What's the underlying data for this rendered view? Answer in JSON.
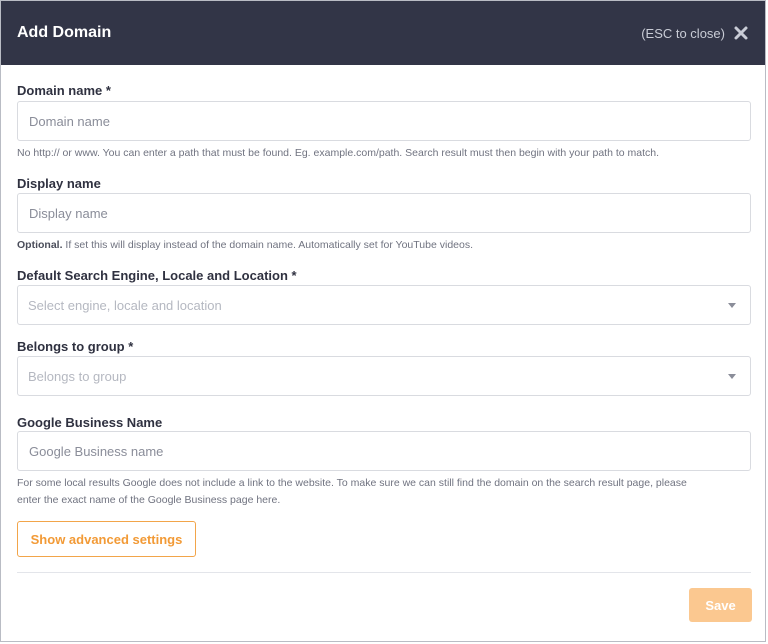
{
  "header": {
    "title": "Add Domain",
    "esc_hint": "(ESC to close)"
  },
  "form": {
    "domain_name": {
      "label": "Domain name *",
      "placeholder": "Domain name",
      "help": "No http:// or www. You can enter a path that must be found. Eg. example.com/path. Search result must then begin with your path to match."
    },
    "display_name": {
      "label": "Display name",
      "placeholder": "Display name",
      "help_bold": "Optional.",
      "help": " If set this will display instead of the domain name. Automatically set for YouTube videos."
    },
    "search_engine": {
      "label": "Default Search Engine, Locale and Location *",
      "placeholder": "Select engine, locale and location"
    },
    "group": {
      "label": "Belongs to group *",
      "placeholder": "Belongs to group"
    },
    "google_business": {
      "label": "Google Business Name",
      "placeholder": "Google Business name",
      "help_line1": "For some local results Google does not include a link to the website. To make sure we can still find the domain on the search result page, please",
      "help_line2": "enter the exact name of the Google Business page here."
    }
  },
  "buttons": {
    "advanced": "Show advanced settings",
    "save": "Save"
  },
  "colors": {
    "header_bg": "#323547",
    "accent": "#f29a36",
    "save_disabled": "#fbc890"
  }
}
